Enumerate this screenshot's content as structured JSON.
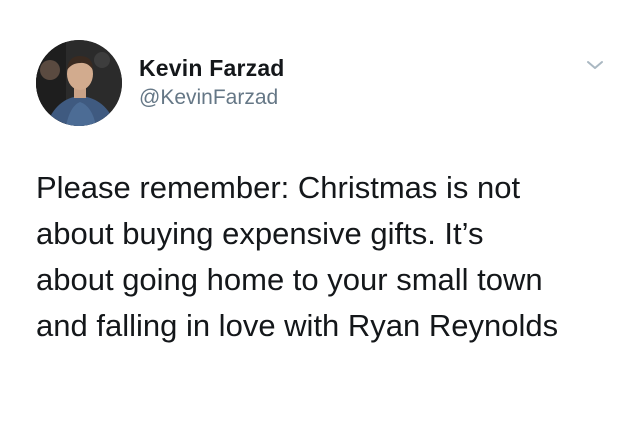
{
  "tweet": {
    "author": {
      "display_name": "Kevin Farzad",
      "handle": "@KevinFarzad",
      "avatar_icon": "user-photo-avatar"
    },
    "menu_icon": "chevron-down-icon",
    "body_lines": [
      "Please remember: Christmas is not",
      "about buying expensive gifts. It’s",
      "about going home to your small town",
      "and falling in love with Ryan Reynolds"
    ]
  },
  "colors": {
    "text": "#14171a",
    "handle": "#657786",
    "caret": "#aab8c2",
    "background": "#ffffff"
  }
}
